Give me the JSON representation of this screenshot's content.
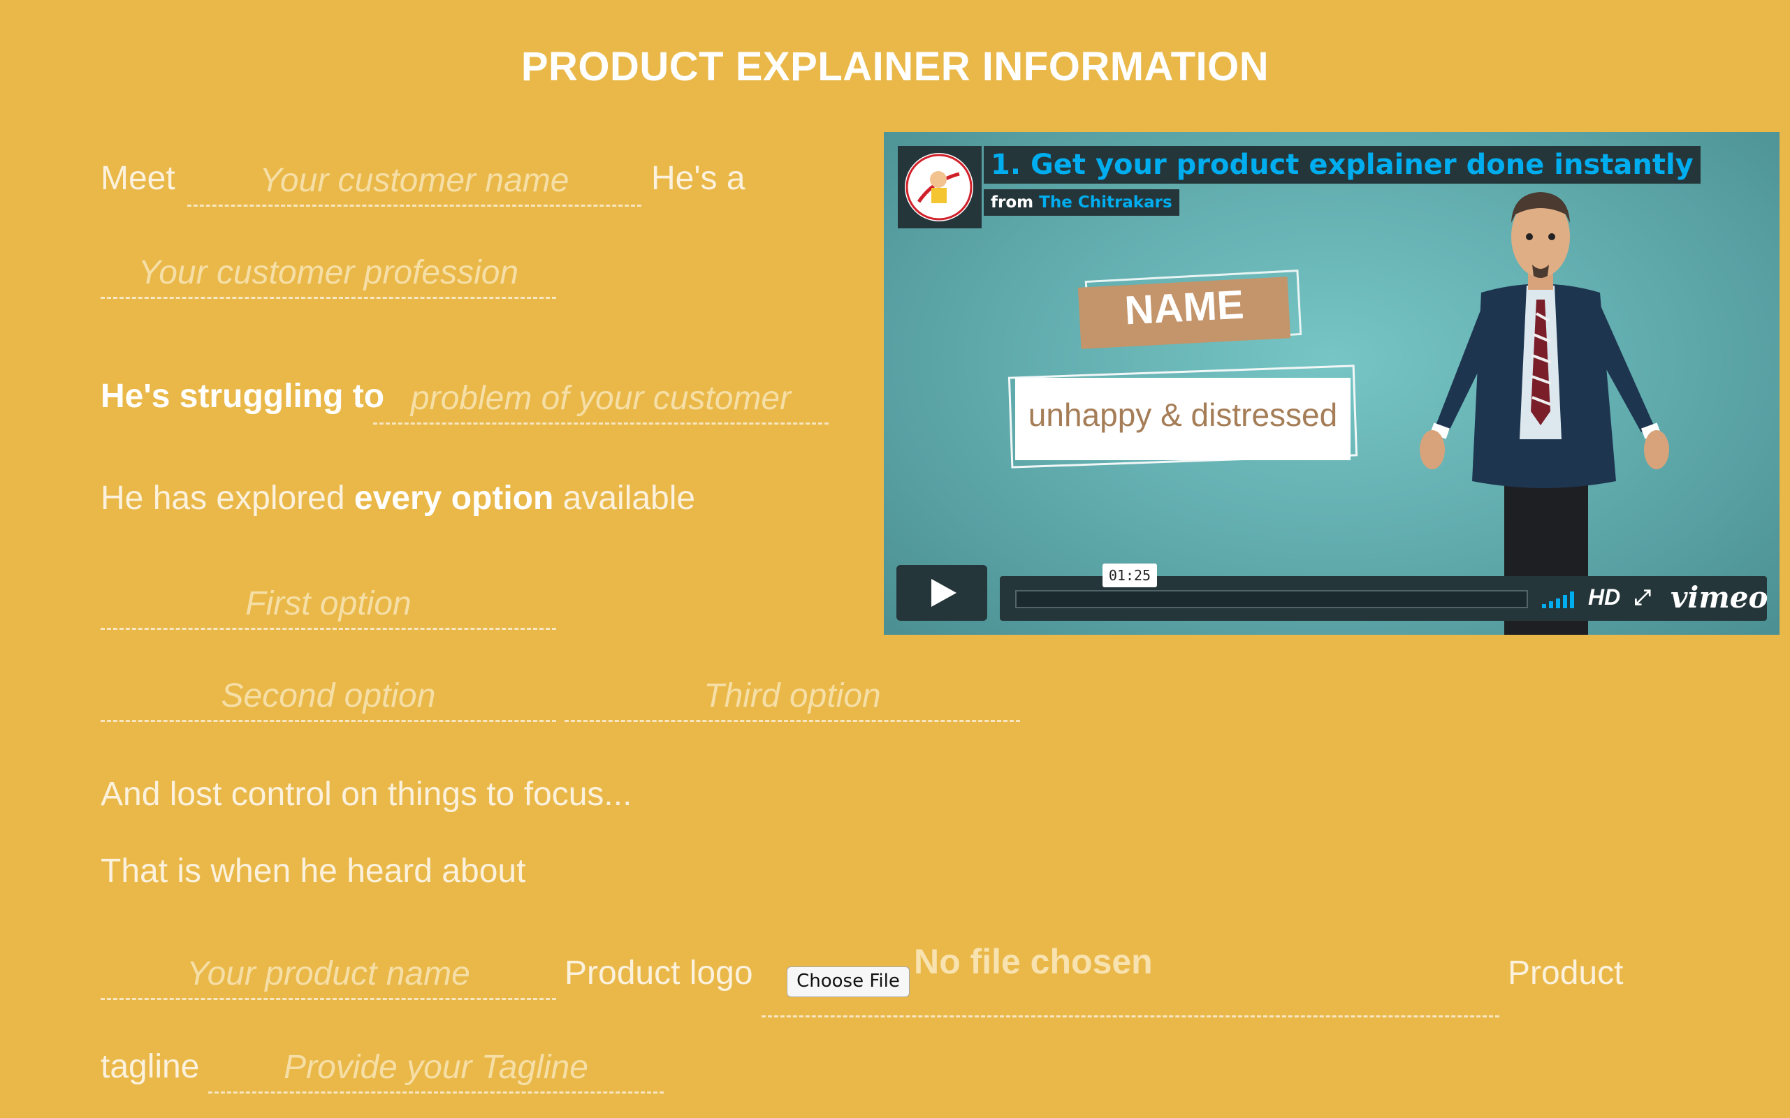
{
  "page": {
    "title": "PRODUCT EXPLAINER INFORMATION"
  },
  "form": {
    "meet_label": "Meet",
    "customer_name_placeholder": "Your customer name",
    "hes_a_label": "He's a",
    "customer_profession_placeholder": "Your customer profession",
    "struggling_label": "He's struggling to",
    "problem_placeholder": "problem of your customer",
    "explored_prefix": "He has explored",
    "explored_bold": "every option",
    "explored_suffix": "available",
    "first_option_placeholder": "First option",
    "second_option_placeholder": "Second option",
    "third_option_placeholder": "Third option",
    "lost_control_text": "And lost control on things to focus...",
    "heard_about_text": "That is when he heard about",
    "product_name_placeholder": "Your product name",
    "product_logo_label": "Product logo",
    "choose_file_label": "Choose File",
    "file_status": "No file chosen",
    "product_label": "Product",
    "tagline_label": "tagline",
    "tagline_placeholder": "Provide your Tagline"
  },
  "video": {
    "title": "1. Get your product explainer done instantly",
    "byline_prefix": "from",
    "author": "The Chitrakars",
    "tag_name": "NAME",
    "tag_emotion": "unhappy & distressed",
    "time": "01:25",
    "hd_label": "HD",
    "brand": "vimeo",
    "colors": {
      "accent": "#00ADEF",
      "panel": "#25363A",
      "background": "#E9B849"
    }
  }
}
